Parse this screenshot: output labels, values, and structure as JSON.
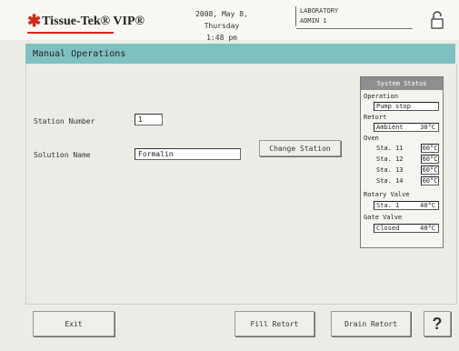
{
  "header": {
    "brand": "Tissue-Tek® VIP®",
    "date": "2008, May 8, Thursday",
    "time": "1:48 pm",
    "lab": "LABORATORY",
    "user": "ADMIN 1",
    "lock_icon": "padlock-icon"
  },
  "title": "Manual Operations",
  "form": {
    "station_number_label": "Station Number",
    "station_number_value": "1",
    "solution_name_label": "Solution Name",
    "solution_name_value": "Formalin",
    "change_station": "Change Station"
  },
  "system_status": {
    "title": "System Status",
    "operation_label": "Operation",
    "operation_value": "Pump stop",
    "retort_label": "Retort",
    "retort_value": "Ambient",
    "retort_temp": "30°C",
    "oven_label": "Oven",
    "oven_stations": [
      {
        "name": "Sta. 11",
        "temp": "60°C"
      },
      {
        "name": "Sta. 12",
        "temp": "60°C"
      },
      {
        "name": "Sta. 13",
        "temp": "60°C"
      },
      {
        "name": "Sta. 14",
        "temp": "60°C"
      }
    ],
    "rotary_label": "Rotary Valve",
    "rotary_value": "Sta. 1",
    "rotary_temp": "40°C",
    "gate_label": "Gate Valve",
    "gate_value": "Closed",
    "gate_temp": "40°C"
  },
  "buttons": {
    "exit": "Exit",
    "fill_retort": "Fill Retort",
    "drain_retort": "Drain Retort",
    "help": "?"
  },
  "colors": {
    "title_bar": "#7fc1c3",
    "brand_red": "#d8251a",
    "status_header": "#8e8e8e"
  }
}
